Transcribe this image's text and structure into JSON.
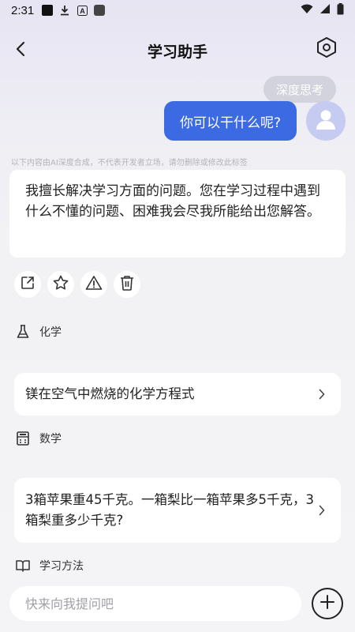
{
  "status_bar": {
    "time": "2:31",
    "icons": [
      "app-icon",
      "download-icon",
      "text-icon",
      "app-square-icon",
      "wifi-icon",
      "signal-icon",
      "battery-icon"
    ]
  },
  "header": {
    "title": "学习助手",
    "back_icon": "back-arrow-icon",
    "settings_icon": "hexagon-settings-icon"
  },
  "chat": {
    "deep_think_label": "深度思考",
    "user_message": "你可以干什么呢?",
    "disclaimer": "以下内容由AI深度合成，不代表开发者立场，请勿删除或修改此标签",
    "answer": "我擅长解决学习方面的问题。您在学习过程中遇到什么不懂的问题、困难我会尽我所能给出您解答。"
  },
  "actions": [
    "share-icon",
    "star-icon",
    "warning-icon",
    "trash-icon"
  ],
  "sections": [
    {
      "icon": "flask-icon",
      "label": "化学",
      "question": "镁在空气中燃烧的化学方程式"
    },
    {
      "icon": "calculator-icon",
      "label": "数学",
      "question": "3箱苹果重45千克。一箱梨比一箱苹果多5千克，3箱梨重多少千克?"
    },
    {
      "icon": "book-icon",
      "label": "学习方法"
    }
  ],
  "input": {
    "placeholder": "快来向我提问吧"
  },
  "colors": {
    "accent": "#3b6ae3",
    "avatar_bg": "#c5cbf1",
    "chip_bg": "#d2d3dc"
  }
}
